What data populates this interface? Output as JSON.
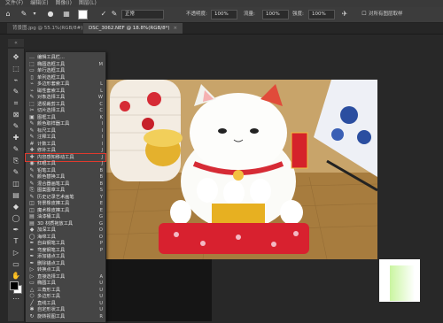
{
  "menubar": {
    "items": [
      "文件(F)",
      "编辑(E)",
      "图像(I)",
      "图层(L)"
    ]
  },
  "optionsbar": {
    "mode_label": "模式:",
    "mode_value": "正常",
    "opacity_label": "不透明度:",
    "opacity_value": "100%",
    "flow_label": "流量:",
    "flow_value": "100%",
    "strength_label": "强度:",
    "strength_value": "100%",
    "sample_label": "对所有图层取样"
  },
  "tabs": [
    {
      "label": "背景图.jpg @ 55.1%(RGB/8#)",
      "close": "×"
    },
    {
      "label": "DSC_3062.NEF @ 18.8%(RGB/8*)",
      "close": "×"
    }
  ],
  "toolbar": {
    "collapse": "«"
  },
  "tool_menu": {
    "items": [
      {
        "icon": "…",
        "label": "编辑工具栏...",
        "shortcut": ""
      },
      {
        "icon": "⬚",
        "label": "椭圆选框工具",
        "shortcut": "M"
      },
      {
        "icon": "▭",
        "label": "单行选框工具",
        "shortcut": ""
      },
      {
        "icon": "▯",
        "label": "单列选框工具",
        "shortcut": ""
      },
      {
        "icon": "⌁",
        "label": "多边形套索工具",
        "shortcut": "L"
      },
      {
        "icon": "⌁",
        "label": "磁性套索工具",
        "shortcut": "L"
      },
      {
        "icon": "✎",
        "label": "对象选择工具",
        "shortcut": "W"
      },
      {
        "icon": "⬚",
        "label": "透视裁剪工具",
        "shortcut": "C"
      },
      {
        "icon": "✂",
        "label": "切片选择工具",
        "shortcut": "C"
      },
      {
        "icon": "▣",
        "label": "图框工具",
        "shortcut": "K"
      },
      {
        "icon": "✎",
        "label": "颜色取样器工具",
        "shortcut": "I"
      },
      {
        "icon": "✎",
        "label": "标尺工具",
        "shortcut": "I"
      },
      {
        "icon": "✎",
        "label": "注释工具",
        "shortcut": "I"
      },
      {
        "icon": "#",
        "label": "计数工具",
        "shortcut": "I"
      },
      {
        "icon": "✚",
        "label": "修补工具",
        "shortcut": "J"
      },
      {
        "icon": "✚",
        "label": "内容感知移动工具",
        "shortcut": "J"
      },
      {
        "icon": "◉",
        "label": "红眼工具",
        "shortcut": "J"
      },
      {
        "icon": "✎",
        "label": "铅笔工具",
        "shortcut": "B"
      },
      {
        "icon": "✎",
        "label": "颜色替换工具",
        "shortcut": "B"
      },
      {
        "icon": "✎",
        "label": "混合器画笔工具",
        "shortcut": "B"
      },
      {
        "icon": "⎘",
        "label": "图案图章工具",
        "shortcut": "S"
      },
      {
        "icon": "✎",
        "label": "历史记录艺术画笔",
        "shortcut": "Y"
      },
      {
        "icon": "◫",
        "label": "背景橡皮擦工具",
        "shortcut": "E"
      },
      {
        "icon": "◫",
        "label": "魔术橡皮擦工具",
        "shortcut": "E"
      },
      {
        "icon": "▤",
        "label": "油漆桶工具",
        "shortcut": "G"
      },
      {
        "icon": "▤",
        "label": "3D 材质拖放工具",
        "shortcut": "G"
      },
      {
        "icon": "◆",
        "label": "加深工具",
        "shortcut": "O"
      },
      {
        "icon": "◯",
        "label": "海绵工具",
        "shortcut": "O"
      },
      {
        "icon": "✒",
        "label": "自由钢笔工具",
        "shortcut": "P"
      },
      {
        "icon": "✒",
        "label": "弯度钢笔工具",
        "shortcut": "P"
      },
      {
        "icon": "✒",
        "label": "添加锚点工具",
        "shortcut": ""
      },
      {
        "icon": "✒",
        "label": "删除锚点工具",
        "shortcut": ""
      },
      {
        "icon": "▷",
        "label": "转换点工具",
        "shortcut": ""
      },
      {
        "icon": "▷",
        "label": "直接选择工具",
        "shortcut": "A"
      },
      {
        "icon": "▭",
        "label": "椭圆工具",
        "shortcut": "U"
      },
      {
        "icon": "△",
        "label": "三角形工具",
        "shortcut": "U"
      },
      {
        "icon": "⬡",
        "label": "多边形工具",
        "shortcut": "U"
      },
      {
        "icon": "╱",
        "label": "直线工具",
        "shortcut": "U"
      },
      {
        "icon": "✱",
        "label": "自定形状工具",
        "shortcut": "U"
      },
      {
        "icon": "↻",
        "label": "旋转视图工具",
        "shortcut": "R"
      }
    ],
    "highlighted_index": 15
  }
}
